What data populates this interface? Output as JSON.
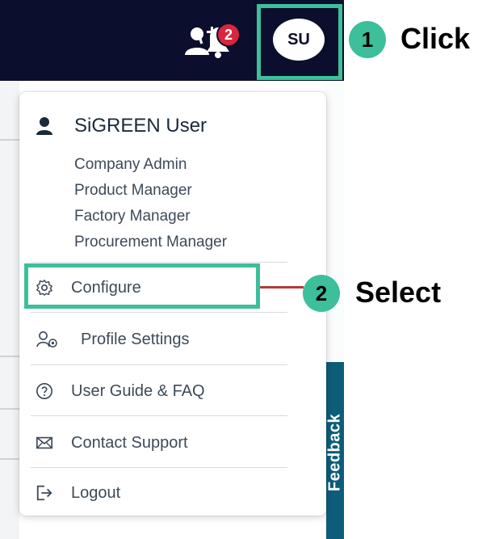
{
  "header": {
    "notification_count": "2",
    "avatar_initials": "SU"
  },
  "menu": {
    "user_name": "SiGREEN User",
    "roles": [
      "Company Admin",
      "Product Manager",
      "Factory Manager",
      "Procurement Manager"
    ],
    "items": [
      {
        "label": "Configure",
        "icon": "gear-icon"
      },
      {
        "label": "Profile Settings",
        "icon": "user-settings-icon"
      },
      {
        "label": "User Guide & FAQ",
        "icon": "help-circle-icon"
      },
      {
        "label": "Contact Support",
        "icon": "mail-icon"
      },
      {
        "label": "Logout",
        "icon": "logout-icon"
      }
    ]
  },
  "side": {
    "feedback_label": "Feedback"
  },
  "annotations": {
    "step1_number": "1",
    "step1_label": "Click",
    "step2_number": "2",
    "step2_label": "Select",
    "highlight_color": "#3cbf9a",
    "connector_color": "#b23b3b"
  }
}
